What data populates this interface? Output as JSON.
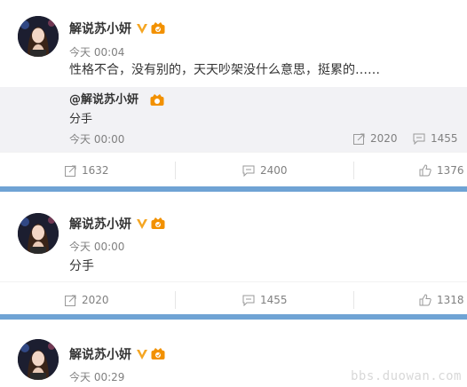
{
  "colors": {
    "divider": "#6fa3d4",
    "badge_v": "#f5a623",
    "level": "#f29100"
  },
  "posts": [
    {
      "user": "解说苏小妍",
      "time": "今天 00:04",
      "text": "性格不合，没有别的，天天吵架没什么意思，挺累的……",
      "repost": {
        "user": "@解说苏小妍",
        "text": "分手",
        "time": "今天 00:00",
        "reposts": "2020",
        "comments": "1455"
      },
      "actions": {
        "reposts": "1632",
        "comments": "2400",
        "likes": "1376"
      }
    },
    {
      "user": "解说苏小妍",
      "time": "今天 00:00",
      "text": "分手",
      "actions": {
        "reposts": "2020",
        "comments": "1455",
        "likes": "1318"
      }
    },
    {
      "user": "解说苏小妍",
      "time": "今天 00:29"
    }
  ],
  "watermark": "bbs.duowan.com"
}
